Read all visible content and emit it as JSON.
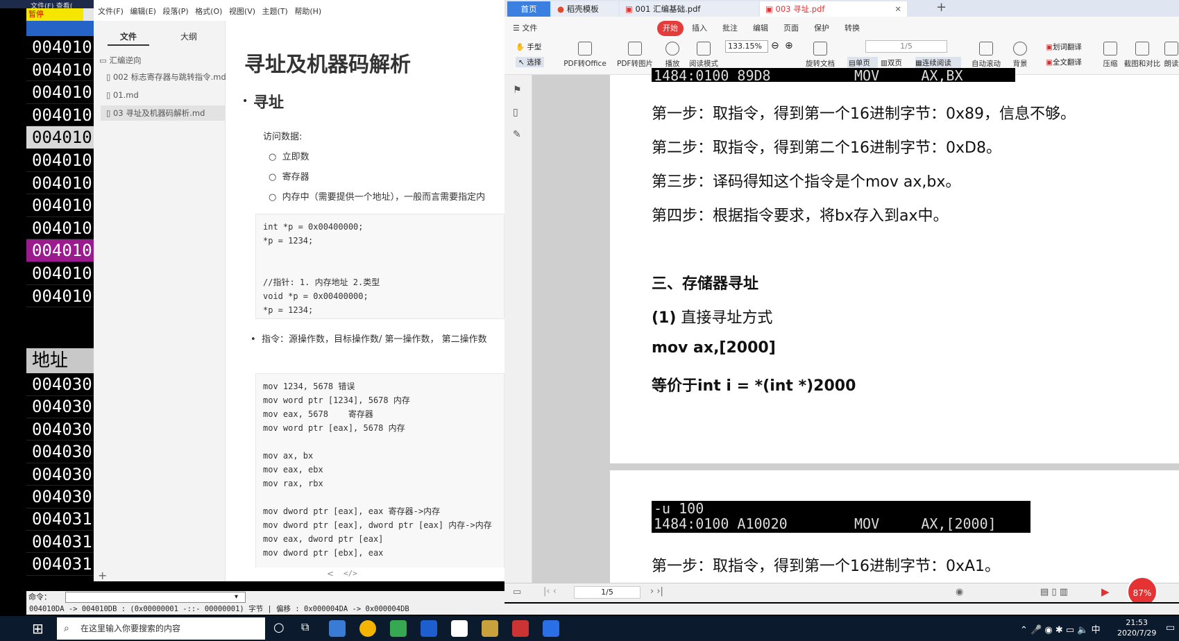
{
  "debugger": {
    "menu": "文件(F)    查看(",
    "pause_label": "暂停",
    "rows": [
      "004010",
      "004010",
      "004010",
      "004010",
      "004010",
      "004010",
      "004010",
      "004010",
      "004010",
      "004010",
      "004010",
      "004010"
    ],
    "addr_header": "地址",
    "rows2": [
      "004030",
      "004030",
      "004030",
      "004030",
      "004030",
      "004030",
      "004031",
      "004031",
      "004031"
    ],
    "cmd_label": "命令：",
    "status_text": "004010DA -> 004010DB : (0x00000001  -::- 00000001) 字节   |  偏移 : 0x000004DA -> 0x000004DB"
  },
  "typora": {
    "menu": [
      "文件(F)",
      "编辑(E)",
      "段落(P)",
      "格式(O)",
      "视图(V)",
      "主题(T)",
      "帮助(H)"
    ],
    "tabs": [
      "文件",
      "大纲"
    ],
    "folder": "汇编逆向",
    "files": [
      "002 标志寄存器与跳转指令.md",
      "01.md",
      "03 寻址及机器码解析.md"
    ],
    "title": "寻址及机器码解析",
    "h2": "寻址",
    "access_label": "访问数据:",
    "sub_items": [
      "立即数",
      "寄存器",
      "内存中（需要提供一个地址），一般而言需要指定内"
    ],
    "code1": [
      "int *p = 0x00400000;",
      "*p = 1234;",
      "",
      "",
      "//指针: 1. 内存地址 2.类型",
      "void *p = 0x00400000;",
      "*p = 1234;"
    ],
    "instr_bullet": "指令：源操作数，目标操作数/ 第一操作数， 第二操作数",
    "code2": [
      "mov 1234, 5678 错误",
      "mov word ptr [1234], 5678 内存",
      "mov eax, 5678    寄存器",
      "mov word ptr [eax], 5678 内存",
      "",
      "mov ax, bx",
      "mov eax, ebx",
      "mov rax, rbx",
      "",
      "mov dword ptr [eax], eax 寄存器->内存",
      "mov dword ptr [eax], dword ptr [eax] 内存->内存",
      "mov eax, dword ptr [eax]",
      "mov dword ptr [ebx], eax"
    ],
    "status_left": "<",
    "status_code": "</>",
    "add": "+"
  },
  "wps": {
    "tabs": [
      "首页",
      "稻壳模板",
      "001 汇编基础.pdf",
      "003 寻址.pdf"
    ],
    "new_tab": "+",
    "menu": [
      "文件",
      "开始",
      "插入",
      "批注",
      "编辑",
      "页面",
      "保护",
      "转换"
    ],
    "tools": [
      "手型",
      "选择",
      "PDF转Office",
      "PDF转图片",
      "播放",
      "阅读模式",
      "旋转文档",
      "自动滚动",
      "背景",
      "压缩",
      "截图和对比",
      "朗读"
    ],
    "zoom": "133.15%",
    "page": "1/5",
    "view": [
      "单页",
      "双页",
      "连续阅读"
    ],
    "translate": [
      "划词翻译",
      "全文翻译"
    ],
    "page_top_term": "1484:0100 89D8          MOV     AX,BX",
    "steps1": [
      "第一步：取指令，得到第一个16进制字节：0x89，信息不够。",
      "第二步：取指令，得到第二个16进制字节：0xD8。",
      "第三步：译码得知这个指令是个mov ax,bx。",
      "第四步：根据指令要求，将bx存入到ax中。"
    ],
    "sec3": "三、存储器寻址",
    "sec3_1_num": "(1)",
    "sec3_1_text": "直接寻址方式",
    "mov_line": "mov ax,[2000]",
    "eq_line": "等价于int i = *(int *)2000",
    "term2": [
      "-u 100",
      "1484:0100 A10020        MOV     AX,[2000]"
    ],
    "step2_1": "第一步：取指令，得到第一个16进制字节：0xA1。",
    "bottom_page": "1/5",
    "percent": "87%"
  },
  "taskbar": {
    "search": "在这里输入你要搜索的内容",
    "time": "21:53",
    "date": "2020/7/29",
    "ime": "中"
  }
}
